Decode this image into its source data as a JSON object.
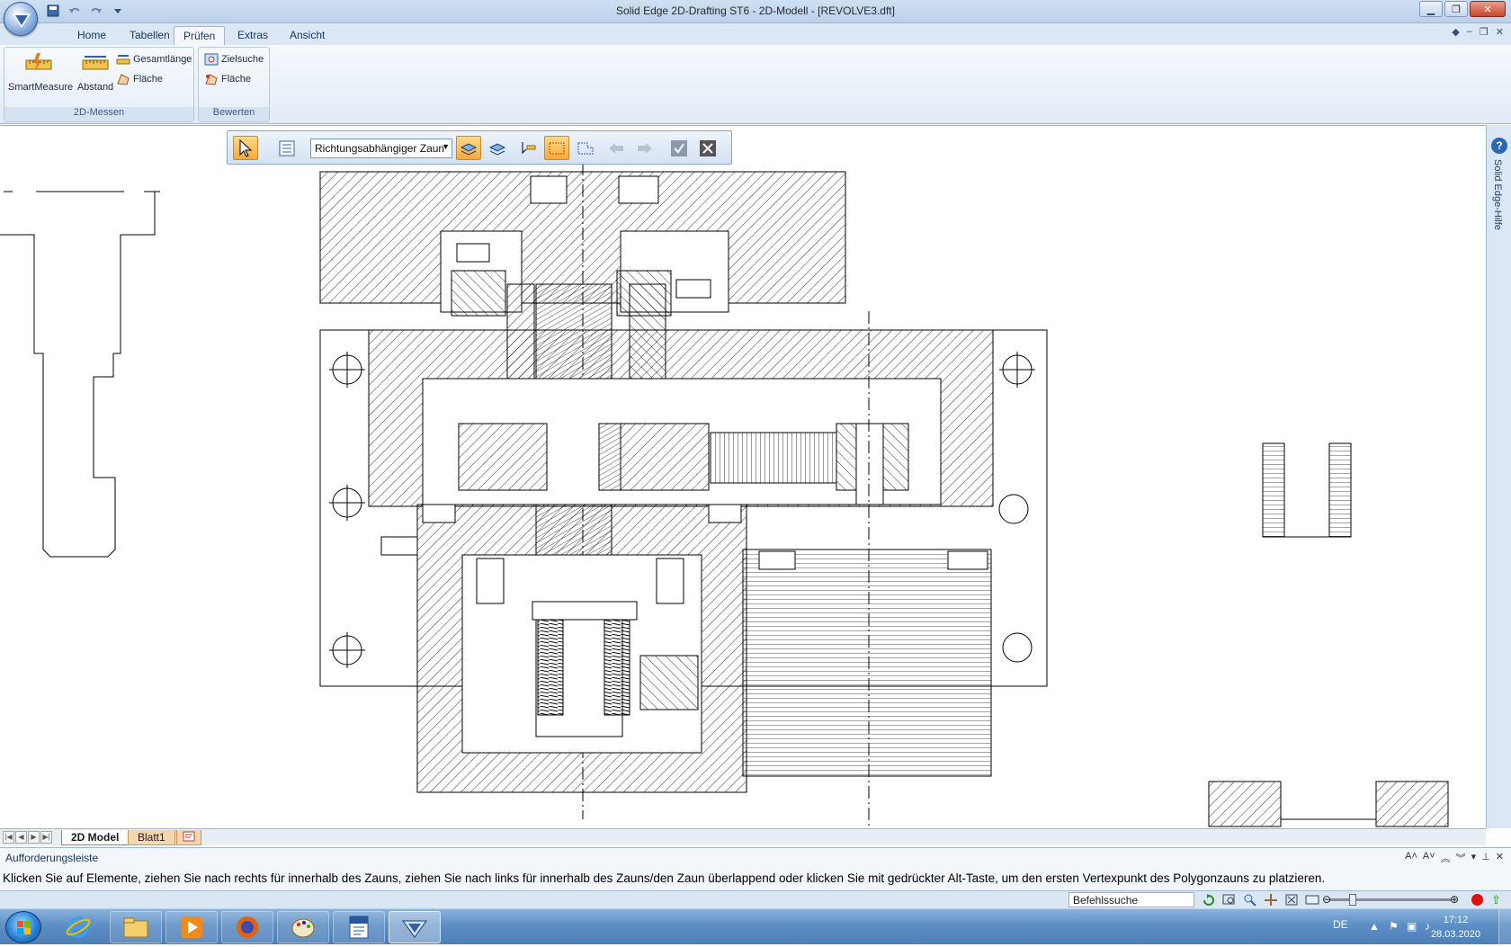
{
  "window": {
    "title": "Solid Edge 2D-Drafting ST6 - 2D-Modell - [REVOLVE3.dft]"
  },
  "ribbon": {
    "tabs": [
      {
        "label": "Home"
      },
      {
        "label": "Tabellen"
      },
      {
        "label": "Prüfen"
      },
      {
        "label": "Extras"
      },
      {
        "label": "Ansicht"
      }
    ],
    "active_tab": "Prüfen",
    "groups": {
      "messen": {
        "label": "2D-Messen",
        "smartmeasure": "SmartMeasure",
        "abstand": "Abstand",
        "gesamtlaenge": "Gesamtlänge",
        "flaeche": "Fläche"
      },
      "bewerten": {
        "label": "Bewerten",
        "zielsuche": "Zielsuche",
        "flaeche": "Fläche"
      }
    }
  },
  "selection_toolbar": {
    "fence_mode": "Richtungsabhängiger Zaun"
  },
  "side_panel": {
    "help_label": "Solid Edge-Hilfe"
  },
  "sheet_tabs": [
    {
      "label": "2D Model",
      "active": true
    },
    {
      "label": "Blatt1",
      "active": false
    }
  ],
  "prompt_bar": {
    "title": "Aufforderungsleiste",
    "text": "Klicken Sie auf Elemente, ziehen Sie nach rechts für innerhalb des Zauns, ziehen Sie nach links für innerhalb des Zauns/den Zaun überlappend oder klicken Sie mit gedrückter Alt-Taste, um den ersten Vertexpunkt des Polygonzauns zu platzieren."
  },
  "status_bar": {
    "command_search": "Befehlssuche"
  },
  "taskbar": {
    "language": "DE",
    "time": "17:12",
    "date": "28.03.2020",
    "apps": [
      "internet-explorer",
      "file-explorer",
      "media-player",
      "firefox",
      "paint",
      "word",
      "solid-edge"
    ]
  },
  "colors": {
    "ribbon_bg": "#e1ebf6",
    "accent_orange": "#f7a93a",
    "taskbar_blue": "#5d8ec4",
    "drawing_line": "#000000"
  }
}
